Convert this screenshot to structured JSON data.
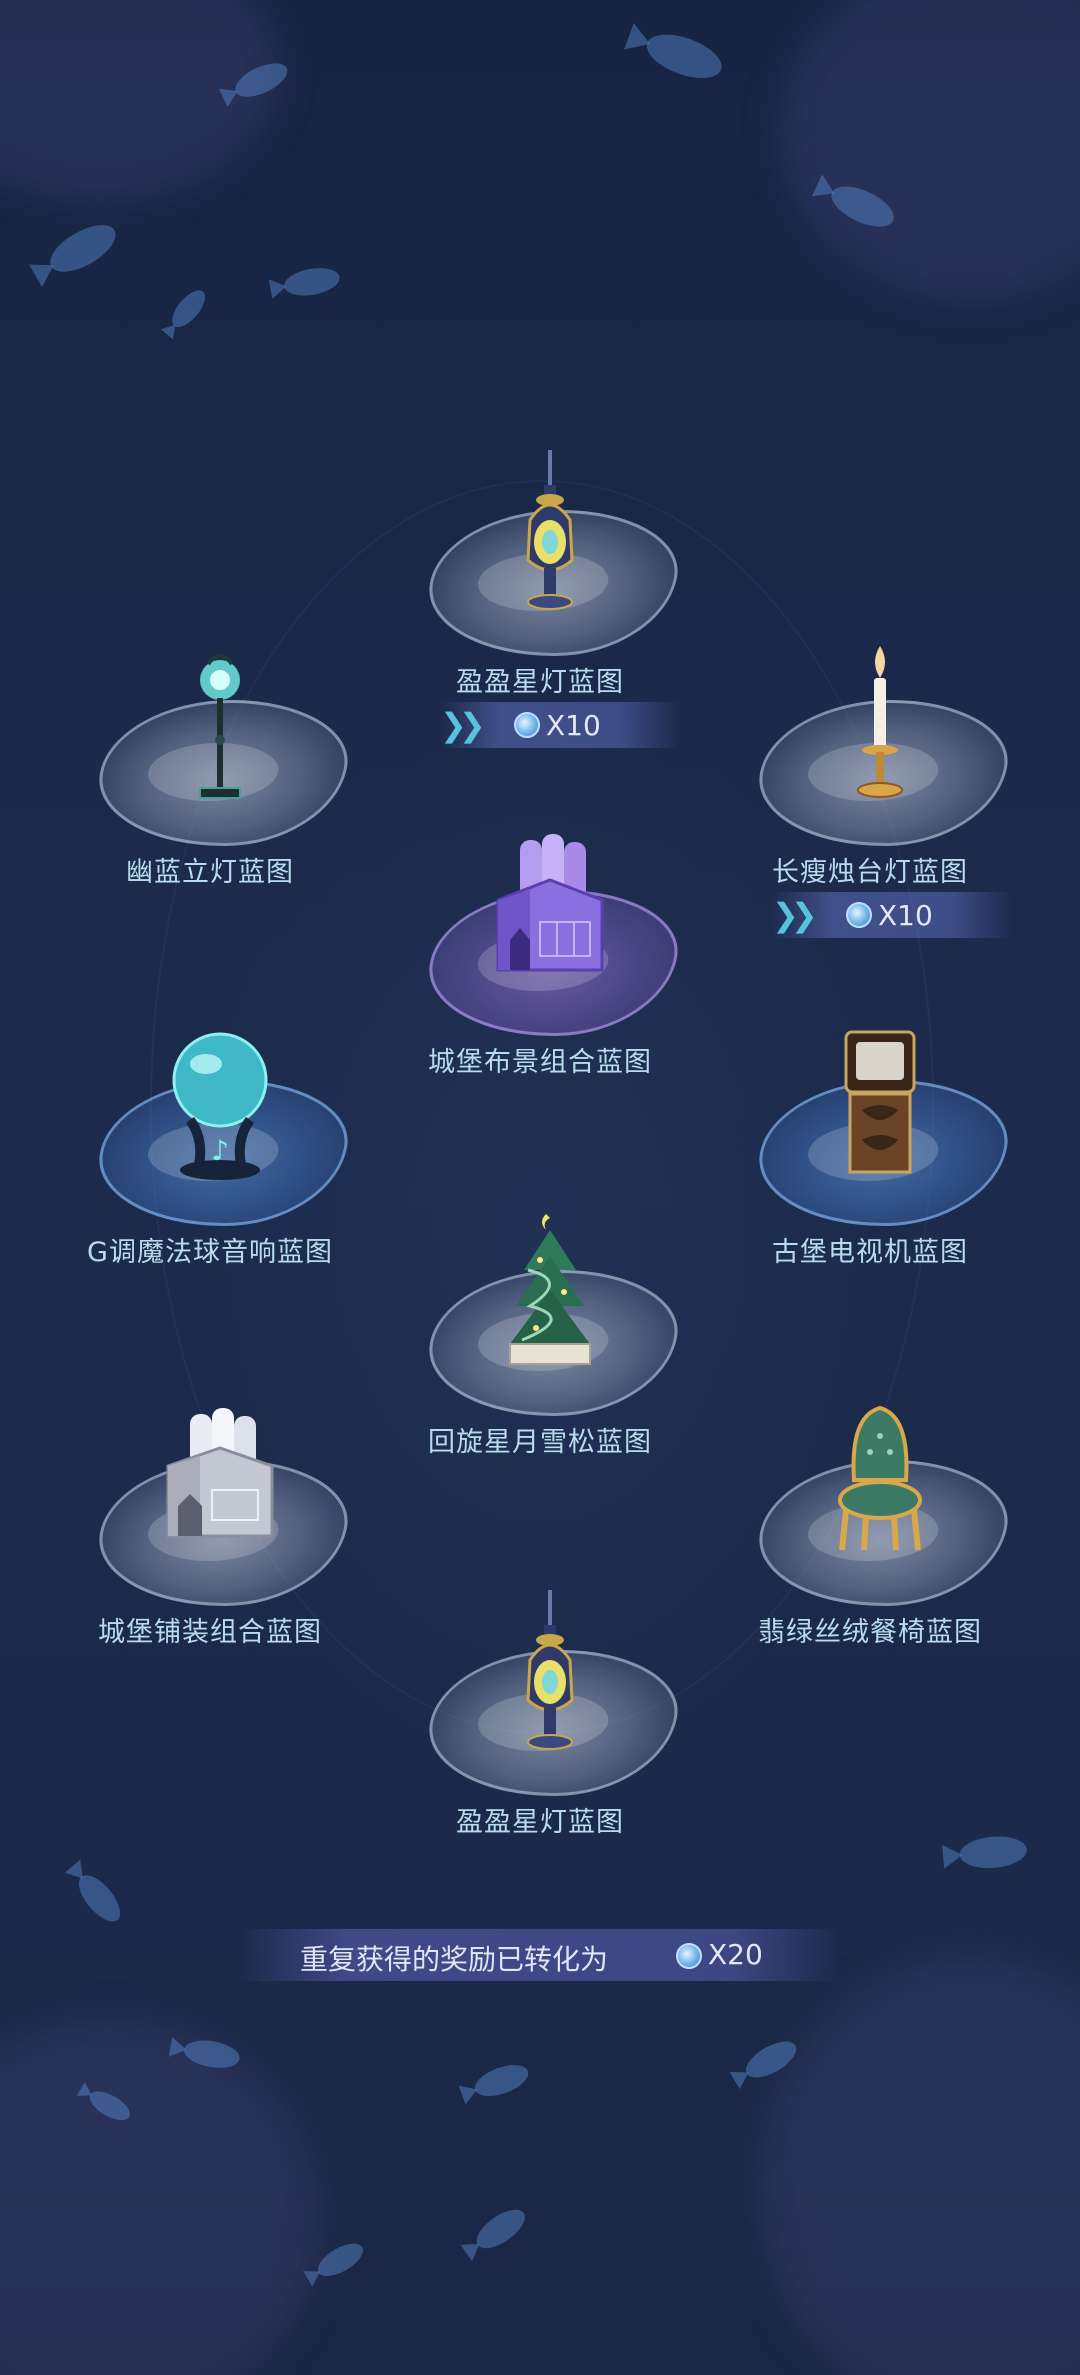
{
  "items": [
    {
      "label": "盈盈星灯蓝图",
      "icon": "star-lamp-icon",
      "bonus": "X10"
    },
    {
      "label": "幽蓝立灯蓝图",
      "icon": "blue-floor-lamp-icon"
    },
    {
      "label": "长瘦烛台灯蓝图",
      "icon": "candlestick-lamp-icon",
      "bonus": "X10"
    },
    {
      "label": "城堡布景组合蓝图",
      "icon": "castle-scenery-set-icon"
    },
    {
      "label": "G调魔法球音响蓝图",
      "icon": "magic-orb-speaker-icon"
    },
    {
      "label": "古堡电视机蓝图",
      "icon": "castle-tv-icon"
    },
    {
      "label": "回旋星月雪松蓝图",
      "icon": "spiral-cedar-tree-icon"
    },
    {
      "label": "城堡铺装组合蓝图",
      "icon": "castle-paving-set-icon"
    },
    {
      "label": "翡绿丝绒餐椅蓝图",
      "icon": "green-velvet-chair-icon"
    },
    {
      "label": "盈盈星灯蓝图",
      "icon": "star-lamp-icon"
    }
  ],
  "footer": {
    "text": "重复获得的奖励已转化为",
    "currency_icon": "blue-gem-coin-icon",
    "value": "X20"
  },
  "colors": {
    "background": "#1c2a4b",
    "label": "#b9dcec",
    "chevron": "#58c3dd"
  }
}
